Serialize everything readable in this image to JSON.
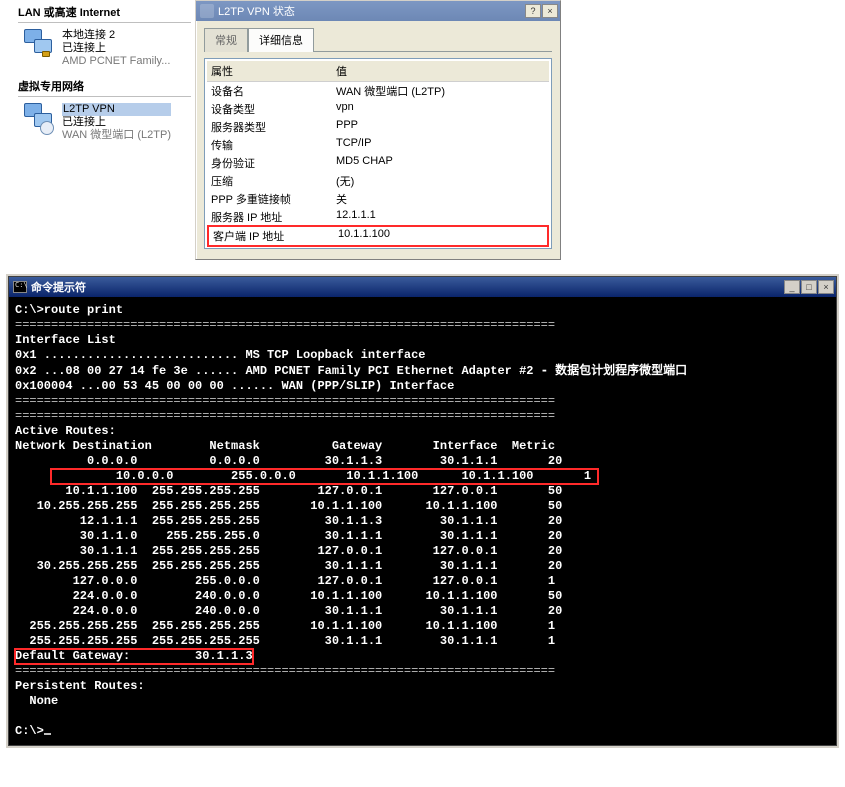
{
  "netcol": {
    "section1": "LAN 或高速 Internet",
    "section2": "虚拟专用网络",
    "conn1": {
      "name": "本地连接 2",
      "status": "已连接上",
      "device": "AMD PCNET Family..."
    },
    "conn2": {
      "name": "L2TP VPN",
      "status": "已连接上",
      "device": "WAN 微型端口 (L2TP)"
    }
  },
  "dlg": {
    "title": "L2TP VPN 状态",
    "help_btn": "?",
    "close_btn": "×",
    "tab_general": "常规",
    "tab_detail": "详细信息",
    "col_attr": "属性",
    "col_val": "值",
    "rows": [
      {
        "k": "设备名",
        "v": "WAN 微型端口 (L2TP)"
      },
      {
        "k": "设备类型",
        "v": "vpn"
      },
      {
        "k": "服务器类型",
        "v": "PPP"
      },
      {
        "k": "传输",
        "v": "TCP/IP"
      },
      {
        "k": "身份验证",
        "v": "MD5 CHAP"
      },
      {
        "k": "压缩",
        "v": "(无)"
      },
      {
        "k": "PPP 多重链接帧",
        "v": "关"
      },
      {
        "k": "服务器 IP 地址",
        "v": "12.1.1.1"
      }
    ],
    "row_hl": {
      "k": "客户端 IP 地址",
      "v": "10.1.1.100"
    }
  },
  "cmd": {
    "title": "命令提示符",
    "min_btn": "_",
    "max_btn": "□",
    "close_btn": "×",
    "prompt1": "C:\\>route print",
    "iface_hdr": "Interface List",
    "iface1": "0x1 ........................... MS TCP Loopback interface",
    "iface2_a": "0x2 ...08 00 27 14 fe 3e ...... AMD PCNET Family PCI Ethernet Adapter #2 ",
    "iface2_b": "- 数据包计划程序微型端口",
    "iface3": "0x100004 ...00 53 45 00 00 00 ...... WAN (PPP/SLIP) Interface",
    "rule": "===========================================================================",
    "active_hdr": "Active Routes:",
    "cols": "Network Destination        Netmask          Gateway       Interface  Metric",
    "routes": [
      "          0.0.0.0          0.0.0.0         30.1.1.3        30.1.1.1       20",
      "         10.0.0.0        255.0.0.0       10.1.1.100      10.1.1.100       1 ",
      "       10.1.1.100  255.255.255.255        127.0.0.1       127.0.0.1       50",
      "   10.255.255.255  255.255.255.255       10.1.1.100      10.1.1.100       50",
      "         12.1.1.1  255.255.255.255         30.1.1.3        30.1.1.1       20",
      "         30.1.1.0    255.255.255.0         30.1.1.1        30.1.1.1       20",
      "         30.1.1.1  255.255.255.255        127.0.0.1       127.0.0.1       20",
      "   30.255.255.255  255.255.255.255         30.1.1.1        30.1.1.1       20",
      "        127.0.0.0        255.0.0.0        127.0.0.1       127.0.0.1       1 ",
      "        224.0.0.0        240.0.0.0       10.1.1.100      10.1.1.100       50",
      "        224.0.0.0        240.0.0.0         30.1.1.1        30.1.1.1       20",
      "  255.255.255.255  255.255.255.255       10.1.1.100      10.1.1.100       1 ",
      "  255.255.255.255  255.255.255.255         30.1.1.1        30.1.1.1       1 "
    ],
    "defgw": "Default Gateway:         30.1.1.3",
    "persist_hdr": "Persistent Routes:",
    "persist_none": "  None",
    "prompt2": "C:\\>"
  }
}
